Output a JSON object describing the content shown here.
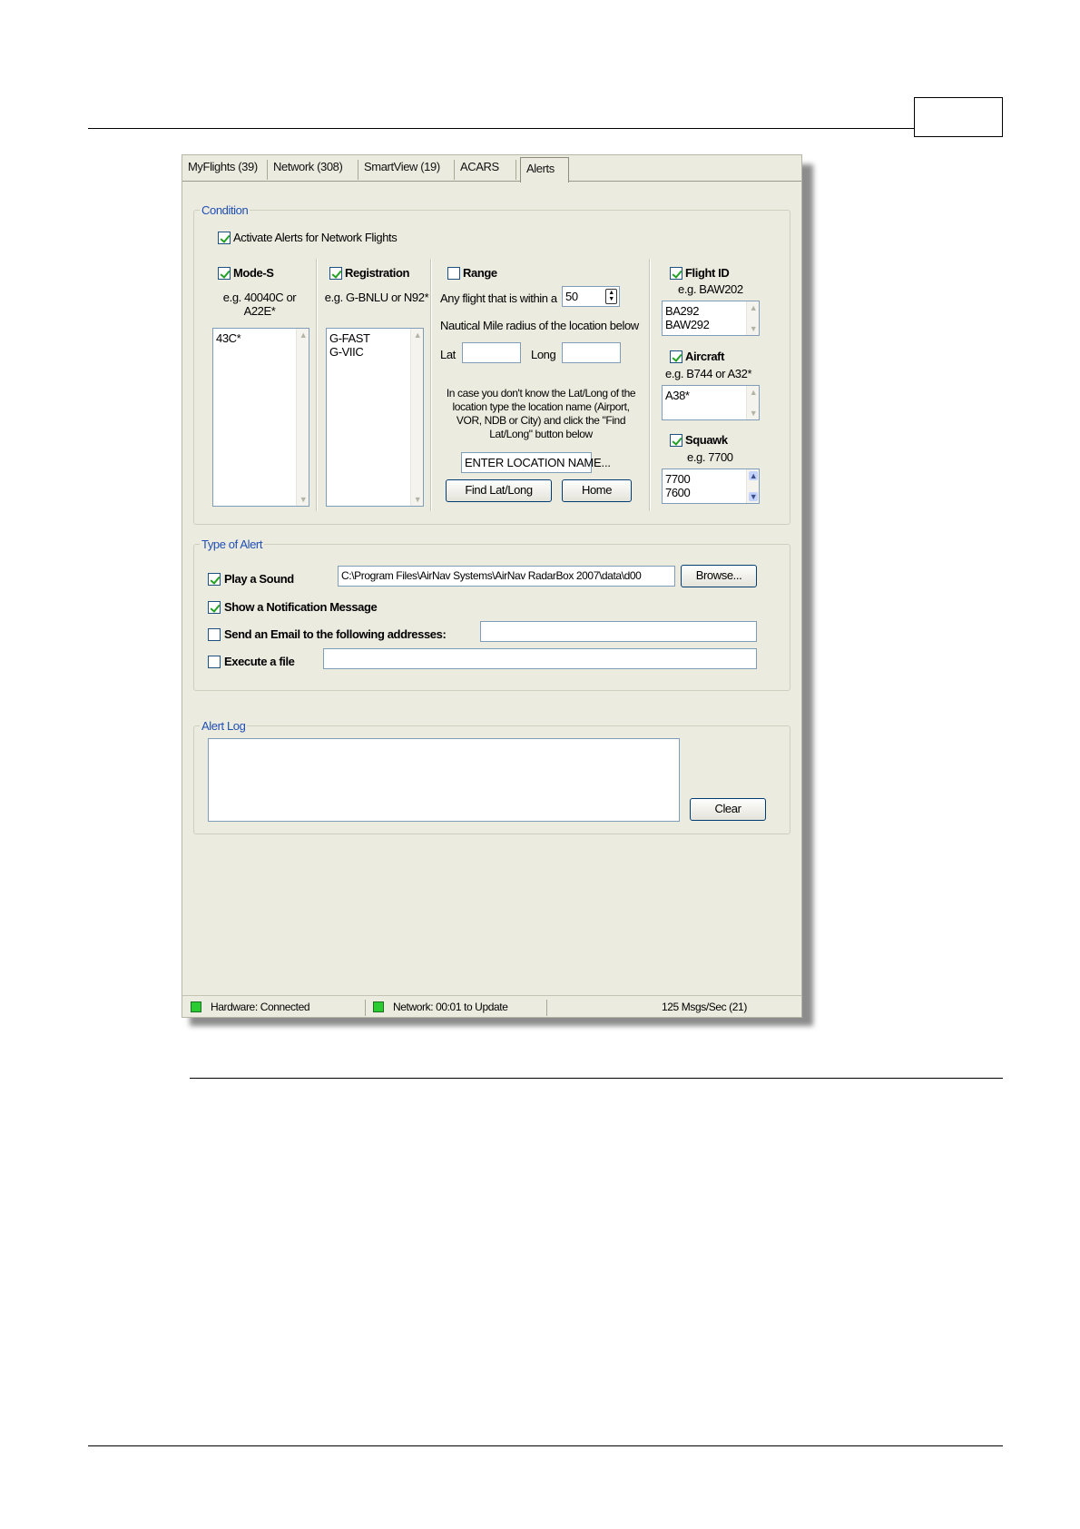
{
  "tabs": [
    {
      "label": "MyFlights (39)",
      "active": false
    },
    {
      "label": "Network (308)",
      "active": false
    },
    {
      "label": "SmartView (19)",
      "active": false
    },
    {
      "label": "ACARS",
      "active": false
    },
    {
      "label": "Alerts",
      "active": true
    }
  ],
  "condition": {
    "legend": "Condition",
    "activate_label": "Activate Alerts for Network Flights",
    "activate_checked": true,
    "mode_s": {
      "label": "Mode-S",
      "checked": true,
      "hint": "e.g. 40040C or A22E*",
      "list": "43C*"
    },
    "registration": {
      "label": "Registration",
      "checked": true,
      "hint": "e.g. G-BNLU or N92*",
      "list": "G-FAST\nG-VIIC"
    },
    "range": {
      "label": "Range",
      "checked": false,
      "within_label": "Any flight that is within a",
      "within_value": "50",
      "radius_label": "Nautical Mile radius of the location below",
      "lat_label": "Lat",
      "long_label": "Long",
      "lat_value": "",
      "long_value": "",
      "help": "In case you don't know the Lat/Long of the location type the location name (Airport, VOR, NDB or City) and click the \"Find Lat/Long\" button below",
      "location_value": "ENTER LOCATION NAME...",
      "find_button": "Find Lat/Long",
      "home_button": "Home"
    },
    "flight_id": {
      "label": "Flight ID",
      "checked": true,
      "hint": "e.g. BAW202",
      "list": "BA292\nBAW292"
    },
    "aircraft": {
      "label": "Aircraft",
      "checked": true,
      "hint": "e.g. B744 or A32*",
      "list": "A38*"
    },
    "squawk": {
      "label": "Squawk",
      "checked": true,
      "hint": "e.g. 7700",
      "list": "7700\n7600"
    }
  },
  "alert_type": {
    "legend": "Type of Alert",
    "play_sound": {
      "label": "Play a Sound",
      "checked": true,
      "path": "C:\\Program Files\\AirNav Systems\\AirNav RadarBox 2007\\data\\d00",
      "browse": "Browse..."
    },
    "notify": {
      "label": "Show a Notification Message",
      "checked": true
    },
    "email": {
      "label": "Send an Email to the following addresses:",
      "checked": false,
      "value": ""
    },
    "execute": {
      "label": "Execute a file",
      "checked": false,
      "value": ""
    }
  },
  "alert_log": {
    "legend": "Alert Log",
    "content": "",
    "clear_button": "Clear"
  },
  "status": {
    "hardware": "Hardware: Connected",
    "network": "Network: 00:01 to Update",
    "msgs": "125 Msgs/Sec (21)",
    "led_color": "#2bcc32"
  }
}
